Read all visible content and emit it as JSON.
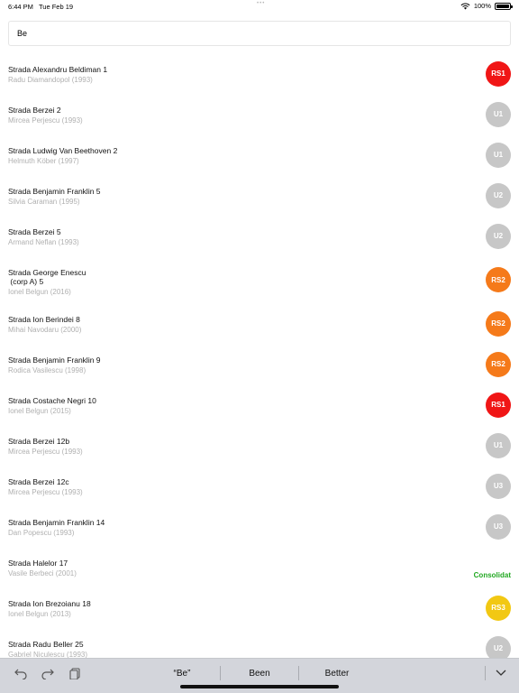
{
  "status_bar": {
    "time": "6:44 PM",
    "date": "Tue Feb 19",
    "dots": "•••",
    "battery_text": "100%"
  },
  "search": {
    "value": "Be",
    "placeholder": ""
  },
  "colors": {
    "RS1": "#f01616",
    "RS2": "#f57a1a",
    "RS3": "#f2c813",
    "U": "#c7c7c7",
    "Consolidat": "#22a822"
  },
  "rows": [
    {
      "name": "Strada Alexandru Beldiman 1",
      "author": "Radu Diamandopol (1993)",
      "badge": "RS1",
      "badge_type": "RS1"
    },
    {
      "name": "Strada Berzei 2",
      "author": "Mircea Perjescu (1993)",
      "badge": "U1",
      "badge_type": "U"
    },
    {
      "name": "Strada Ludwig Van Beethoven 2",
      "author": "Helmuth Köber (1997)",
      "badge": "U1",
      "badge_type": "U"
    },
    {
      "name": "Strada Benjamin Franklin 5",
      "author": "Silvia Caraman (1995)",
      "badge": "U2",
      "badge_type": "U"
    },
    {
      "name": "Strada Berzei 5",
      "author": "Armand Neflan (1993)",
      "badge": "U2",
      "badge_type": "U"
    },
    {
      "name": "Strada George Enescu\n (corp A) 5",
      "author": "Ionel Belgun (2016)",
      "badge": "RS2",
      "badge_type": "RS2"
    },
    {
      "name": "Strada Ion Berindei 8",
      "author": "Mihai Navodaru (2000)",
      "badge": "RS2",
      "badge_type": "RS2"
    },
    {
      "name": "Strada Benjamin Franklin 9",
      "author": "Rodica Vasilescu (1998)",
      "badge": "RS2",
      "badge_type": "RS2"
    },
    {
      "name": "Strada Costache Negri 10",
      "author": "Ionel Belgun (2015)",
      "badge": "RS1",
      "badge_type": "RS1"
    },
    {
      "name": "Strada Berzei 12b",
      "author": "Mircea Perjescu (1993)",
      "badge": "U1",
      "badge_type": "U"
    },
    {
      "name": "Strada Berzei 12c",
      "author": "Mircea Perjescu (1993)",
      "badge": "U3",
      "badge_type": "U"
    },
    {
      "name": "Strada Benjamin Franklin 14",
      "author": "Dan Popescu (1993)",
      "badge": "U3",
      "badge_type": "U"
    },
    {
      "name": "Strada Halelor 17",
      "author": "Vasile Berbeci (2001)",
      "badge": "Consolidat",
      "badge_type": "Consolidat"
    },
    {
      "name": "Strada Ion Brezoianu 18",
      "author": "Ionel Belgun (2013)",
      "badge": "RS3",
      "badge_type": "RS3"
    },
    {
      "name": "Strada Radu Beller 25",
      "author": "Gabriel Niculescu (1993)",
      "badge": "U2",
      "badge_type": "U"
    }
  ],
  "keyboard": {
    "suggestions": [
      "“Be”",
      "Been",
      "Better"
    ],
    "tools": [
      "undo-icon",
      "redo-icon",
      "paste-icon",
      "chevron-down-icon"
    ]
  }
}
